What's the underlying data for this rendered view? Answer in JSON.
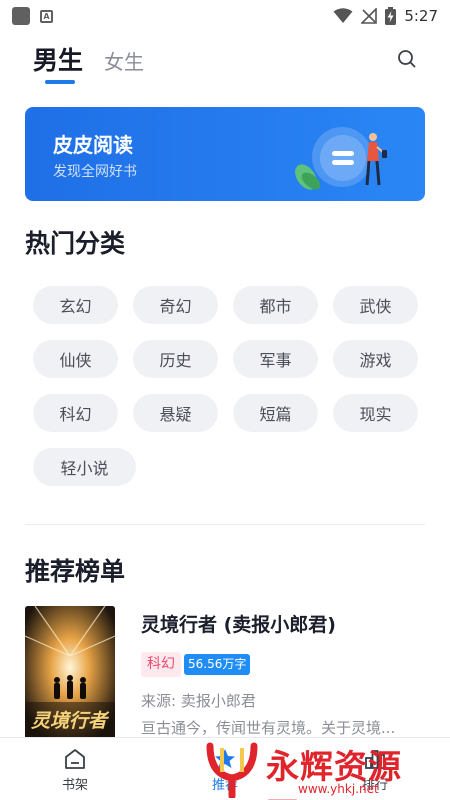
{
  "status_bar": {
    "time": "5:27",
    "notification_letter": "A"
  },
  "header": {
    "tabs": [
      {
        "label": "男生",
        "active": true
      },
      {
        "label": "女生",
        "active": false
      }
    ],
    "accent_color": "#1f7bea",
    "search_icon": "search-icon"
  },
  "banner": {
    "title": "皮皮阅读",
    "subtitle": "发现全网好书",
    "colors": [
      "#1f6fe6",
      "#2a86f5"
    ]
  },
  "categories": {
    "title": "热门分类",
    "items": [
      "玄幻",
      "奇幻",
      "都市",
      "武侠",
      "仙侠",
      "历史",
      "军事",
      "游戏",
      "科幻",
      "悬疑",
      "短篇",
      "现实",
      "轻小说"
    ]
  },
  "ranking": {
    "title": "推荐榜单",
    "books": [
      {
        "title": "灵境行者 (卖报小郎君)",
        "genre": "科幻",
        "count": "56.56万字",
        "source": "来源: 卖报小郎君",
        "description": "亘古通今，传闻世有灵境。关于灵境...",
        "cover_text": "灵境行者"
      }
    ]
  },
  "bottom_nav": {
    "items": [
      {
        "label": "书架",
        "icon": "bookshelf-icon",
        "active": false
      },
      {
        "label": "推荐",
        "icon": "recommend-icon",
        "active": true
      },
      {
        "label": "排行",
        "icon": "rank-icon",
        "active": false
      }
    ]
  },
  "watermark": {
    "text": "永辉资源网",
    "url": "www.yhkj.net"
  }
}
